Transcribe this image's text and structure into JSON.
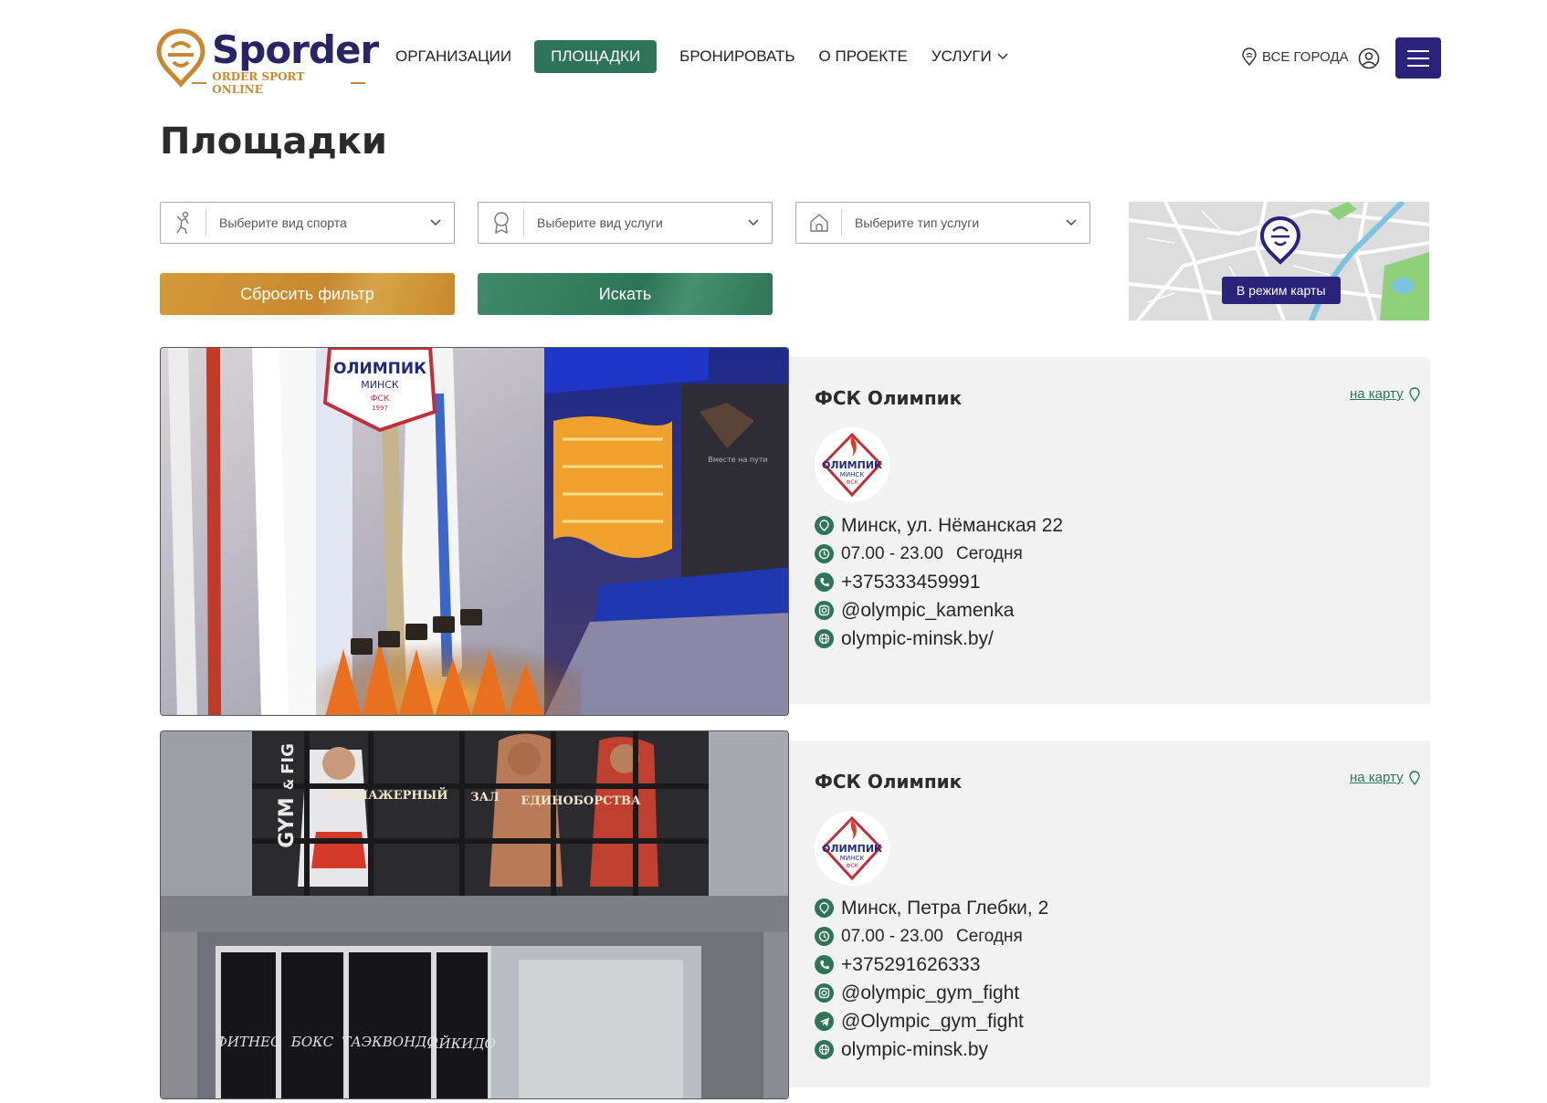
{
  "header": {
    "logo": {
      "word": "Sporder",
      "tagline": "ORDER SPORT ONLINE"
    },
    "nav": [
      {
        "label": "ОРГАНИЗАЦИИ"
      },
      {
        "label": "ПЛОЩАДКИ",
        "active": true
      },
      {
        "label": "БРОНИРОВАТЬ"
      },
      {
        "label": "О ПРОЕКТЕ"
      },
      {
        "label": "УСЛУГИ",
        "has_dropdown": true
      }
    ],
    "city_label": "ВСЕ ГОРОДА",
    "icons": [
      "location-pin-icon",
      "user-icon",
      "hamburger-menu-icon"
    ]
  },
  "page": {
    "title": "Площадки"
  },
  "filters": {
    "sport": {
      "placeholder": "Выберите вид спорта",
      "icon": "athlete-icon"
    },
    "service": {
      "placeholder": "Выберите вид услуги",
      "icon": "medal-icon"
    },
    "service_type": {
      "placeholder": "Выберите тип услуги",
      "icon": "house-icon"
    },
    "reset_label": "Сбросить фильтр",
    "search_label": "Искать",
    "map_mode_label": "В режим карты"
  },
  "venues": [
    {
      "name": "ФСК Олимпик",
      "to_map_label": "на карту",
      "address": "Минск, ул. Нёманская 22",
      "hours": "07.00 - 23.00",
      "day": "Сегодня",
      "phone": "+375333459991",
      "instagram": "@olympic_kamenka",
      "website": "olympic-minsk.by/"
    },
    {
      "name": "ФСК Олимпик",
      "to_map_label": "на карту",
      "address": "Минск, Петра Глебки, 2",
      "hours": "07.00 - 23.00",
      "day": "Сегодня",
      "phone": "+375291626333",
      "instagram": "@olympic_gym_fight",
      "telegram": "@Olympic_gym_fight",
      "website": "olympic-minsk.by"
    }
  ],
  "photo_signage": {
    "logo_text": "ОЛИМПИК",
    "logo_city": "МИНСК",
    "logo_abbr": "ФСК",
    "logo_year": "1997",
    "gym_words": [
      "GYM",
      "&",
      "FIG"
    ],
    "banner_words": [
      "ТРЕНАЖЕРНЫЙ",
      "ЗАЛ",
      "ЕДИНОБОРСТВА"
    ],
    "window_words": [
      "ФИТНЕС",
      "БОКС",
      "ТАЭКВОНДО",
      "АЙКИДО"
    ],
    "wall_text": "Вместе на пути"
  },
  "colors": {
    "primary_green": "#2e7458",
    "accent_gold": "#c8882f",
    "brand_navy": "#2b237a",
    "card_bg": "#f2f2f2"
  }
}
